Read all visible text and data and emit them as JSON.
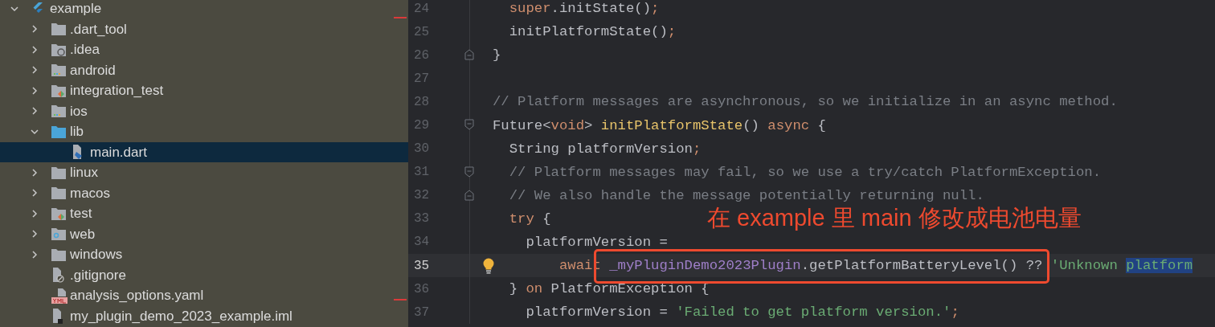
{
  "project_tree": {
    "items": [
      {
        "name": "example",
        "kind": "flutter",
        "expanded": true,
        "selected": false,
        "children": [
          {
            "name": ".dart_tool",
            "kind": "folder",
            "expanded": false,
            "selected": false
          },
          {
            "name": ".idea",
            "kind": "config",
            "expanded": false,
            "selected": false
          },
          {
            "name": "android",
            "kind": "platform",
            "expanded": false,
            "selected": false
          },
          {
            "name": "integration_test",
            "kind": "tests",
            "expanded": false,
            "selected": false
          },
          {
            "name": "ios",
            "kind": "platform",
            "expanded": false,
            "selected": false
          },
          {
            "name": "lib",
            "kind": "source",
            "expanded": true,
            "selected": false,
            "children": [
              {
                "name": "main.dart",
                "kind": "dart",
                "selected": true
              }
            ]
          },
          {
            "name": "linux",
            "kind": "folder",
            "expanded": false,
            "selected": false
          },
          {
            "name": "macos",
            "kind": "folder",
            "expanded": false,
            "selected": false
          },
          {
            "name": "test",
            "kind": "tests",
            "expanded": false,
            "selected": false
          },
          {
            "name": "web",
            "kind": "web",
            "expanded": false,
            "selected": false
          },
          {
            "name": "windows",
            "kind": "folder",
            "expanded": false,
            "selected": false
          },
          {
            "name": ".gitignore",
            "kind": "ignore",
            "selected": false
          },
          {
            "name": "analysis_options.yaml",
            "kind": "yaml",
            "selected": false
          },
          {
            "name": "my_plugin_demo_2023_example.iml",
            "kind": "module",
            "selected": false
          }
        ]
      }
    ]
  },
  "editor": {
    "lines": [
      {
        "number": "24",
        "current": false,
        "kind": "plain",
        "tokens": [
          {
            "text": "  super",
            "kind": "keyword"
          },
          {
            "text": ".initState()",
            "kind": "plain"
          },
          {
            "text": ";",
            "kind": "keyword"
          }
        ]
      },
      {
        "number": "25",
        "current": false,
        "kind": "plain",
        "tokens": [
          {
            "text": "  initPlatformState()",
            "kind": "plain"
          },
          {
            "text": ";",
            "kind": "keyword"
          }
        ]
      },
      {
        "number": "26",
        "current": false,
        "kind": "closer",
        "tokens": [
          {
            "text": "}",
            "kind": "plain"
          }
        ]
      },
      {
        "number": "27",
        "current": false,
        "kind": "plain"
      },
      {
        "number": "28",
        "current": false,
        "kind": "plain",
        "tokens": [
          {
            "text": "// Platform messages are asynchronous, so we initialize in an async method.",
            "kind": "comment"
          }
        ]
      },
      {
        "number": "29",
        "current": false,
        "kind": "opener",
        "tokens": [
          {
            "text": "Future<",
            "kind": "plain"
          },
          {
            "text": "void",
            "kind": "keyword"
          },
          {
            "text": "> ",
            "kind": "plain"
          },
          {
            "text": "initPlatformState",
            "kind": "function"
          },
          {
            "text": "() ",
            "kind": "plain"
          },
          {
            "text": "async",
            "kind": "keyword"
          },
          {
            "text": " {",
            "kind": "plain"
          }
        ]
      },
      {
        "number": "30",
        "current": false,
        "kind": "plain",
        "tokens": [
          {
            "text": "  String platformVersion",
            "kind": "plain"
          },
          {
            "text": ";",
            "kind": "keyword"
          }
        ]
      },
      {
        "number": "31",
        "current": false,
        "kind": "opener",
        "tokens": [
          {
            "text": "  // Platform messages may fail, so we use a try/catch PlatformException.",
            "kind": "comment"
          }
        ]
      },
      {
        "number": "32",
        "current": false,
        "kind": "closer",
        "tokens": [
          {
            "text": "  // We also handle the message potentially returning null.",
            "kind": "comment"
          }
        ]
      },
      {
        "number": "33",
        "current": false,
        "kind": "plain",
        "tokens": [
          {
            "text": "  try",
            "kind": "keyword"
          },
          {
            "text": " {",
            "kind": "plain"
          }
        ]
      },
      {
        "number": "34",
        "current": false,
        "kind": "plain",
        "tokens": [
          {
            "text": "    platformVersion =",
            "kind": "plain"
          }
        ]
      },
      {
        "number": "35",
        "current": true,
        "kind": "plain",
        "tokens": [
          {
            "text": "        await",
            "kind": "keyword"
          },
          {
            "text": " _myPluginDemo2023Plugin",
            "kind": "field"
          },
          {
            "text": ".getPlatformBatteryLevel() ?? ",
            "kind": "plain"
          },
          {
            "text": "'Unknown ",
            "kind": "string"
          },
          {
            "text": "platform",
            "kind": "selection"
          }
        ]
      },
      {
        "number": "36",
        "current": false,
        "kind": "plain",
        "tokens": [
          {
            "text": "  } ",
            "kind": "plain"
          },
          {
            "text": "on",
            "kind": "keyword"
          },
          {
            "text": " PlatformException {",
            "kind": "plain"
          }
        ]
      },
      {
        "number": "37",
        "current": false,
        "kind": "plain",
        "tokens": [
          {
            "text": "    platformVersion = ",
            "kind": "plain"
          },
          {
            "text": "'Failed to get platform version.'",
            "kind": "string"
          },
          {
            "text": ";",
            "kind": "keyword"
          }
        ]
      }
    ]
  },
  "annotation": {
    "text": "在 example 里 main 修改成电池电量"
  }
}
